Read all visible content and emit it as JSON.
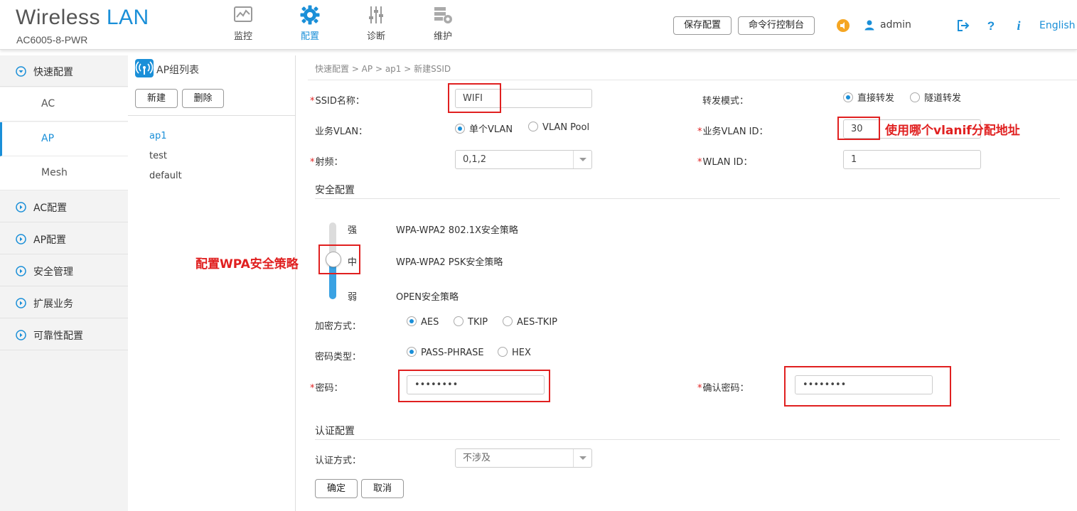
{
  "header": {
    "logo_wireless": "Wireless",
    "logo_lan": "LAN",
    "device": "AC6005-8-PWR",
    "nav": [
      {
        "label": "监控",
        "icon": "monitor-icon"
      },
      {
        "label": "配置",
        "icon": "gear-icon"
      },
      {
        "label": "诊断",
        "icon": "sliders-icon"
      },
      {
        "label": "维护",
        "icon": "maintenance-icon"
      }
    ],
    "save_config": "保存配置",
    "cli_console": "命令行控制台",
    "user": "admin",
    "language": "English",
    "accent_color": "#1a8fd8"
  },
  "sidebar": {
    "groups": [
      {
        "label": "快速配置",
        "expanded": true
      },
      {
        "label": "AC配置"
      },
      {
        "label": "AP配置"
      },
      {
        "label": "安全管理"
      },
      {
        "label": "扩展业务"
      },
      {
        "label": "可靠性配置"
      }
    ],
    "sub_items": [
      "AC",
      "AP",
      "Mesh"
    ],
    "active_sub": "AP"
  },
  "group_list": {
    "title": "AP组列表",
    "new_btn": "新建",
    "delete_btn": "删除",
    "items": [
      "ap1",
      "test",
      "default"
    ],
    "selected": "ap1"
  },
  "main": {
    "breadcrumb": "快速配置 > AP > ap1 > 新建SSID",
    "ssid_label": "SSID名称：",
    "ssid_value": "WIFI",
    "forward_label": "转发模式：",
    "forward_opts": [
      "直接转发",
      "隧道转发"
    ],
    "vlan_label": "业务VLAN：",
    "vlan_opts": [
      "单个VLAN",
      "VLAN Pool"
    ],
    "vlan_id_label": "业务VLAN ID：",
    "vlan_id_value": "30",
    "vlan_id_note": "使用哪个vlanif分配地址",
    "radio_label": "射频：",
    "radio_value": "0,1,2",
    "wlan_id_label": "WLAN ID：",
    "wlan_id_value": "1",
    "security_title": "安全配置",
    "sec_levels": [
      {
        "level": "强",
        "policy": "WPA-WPA2 802.1X安全策略"
      },
      {
        "level": "中",
        "policy": "WPA-WPA2 PSK安全策略"
      },
      {
        "level": "弱",
        "policy": "OPEN安全策略"
      }
    ],
    "sec_note": "配置WPA安全策略",
    "sec_level_selected_fraction": 0.5,
    "enc_label": "加密方式：",
    "enc_opts": [
      "AES",
      "TKIP",
      "AES-TKIP"
    ],
    "pwd_type_label": "密码类型：",
    "pwd_type_opts": [
      "PASS-PHRASE",
      "HEX"
    ],
    "pwd_label": "密码：",
    "pwd_value": "••••••••",
    "confirm_pwd_label": "确认密码：",
    "confirm_pwd_value": "••••••••",
    "auth_title": "认证配置",
    "auth_label": "认证方式：",
    "auth_value": "不涉及",
    "ok_btn": "确定",
    "cancel_btn": "取消"
  }
}
